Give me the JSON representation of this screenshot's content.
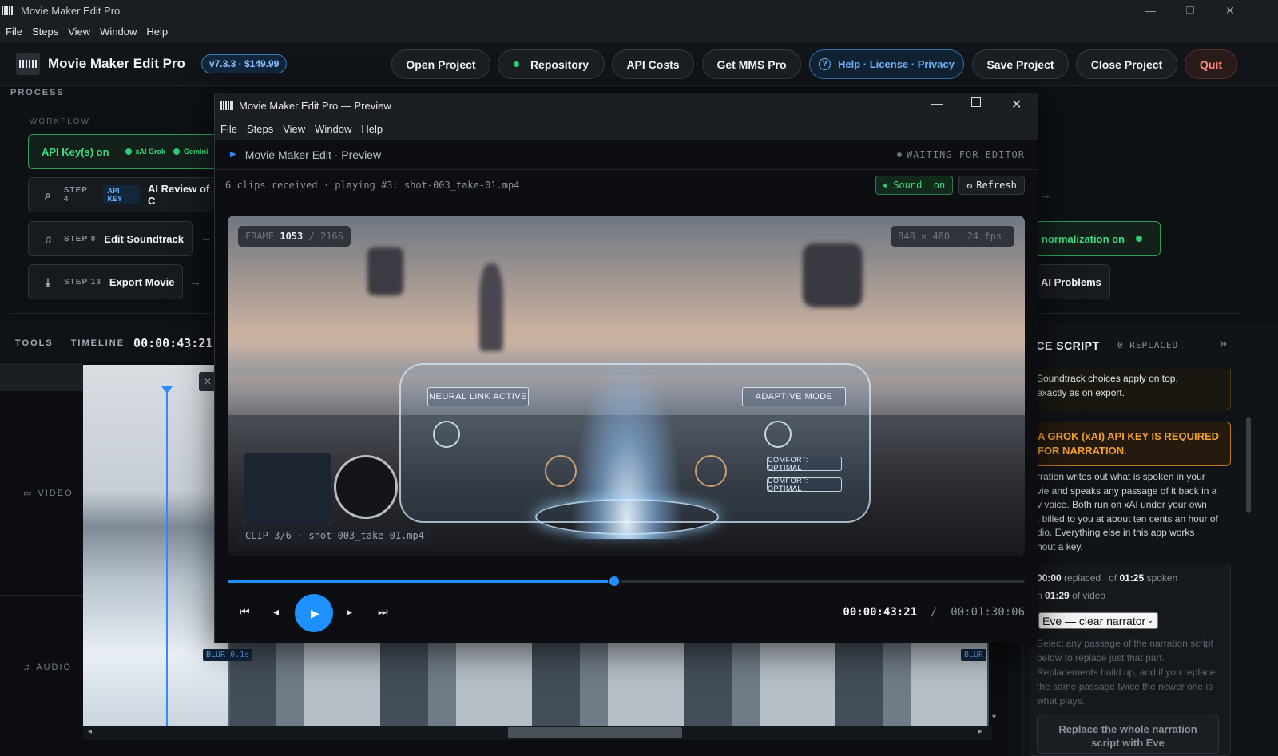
{
  "window": {
    "title": "Movie Maker Edit Pro"
  },
  "menu": [
    "File",
    "Steps",
    "View",
    "Window",
    "Help"
  ],
  "header": {
    "app_name": "Movie Maker Edit Pro",
    "version": "v7.3.3 · $149.99",
    "buttons": {
      "open": "Open Project",
      "repository": "Repository",
      "api_costs": "API Costs",
      "get_pro": "Get MMS Pro",
      "help": "Help · License · Privacy",
      "save": "Save Project",
      "close": "Close Project",
      "quit": "Quit"
    }
  },
  "process": {
    "label": "PROCESS",
    "workflow_label": "WORKFLOW",
    "api_keys": {
      "label": "API Key(s) on",
      "providers": [
        "xAI Grok",
        "Gemini"
      ]
    },
    "steps": [
      {
        "tag": "STEP 4",
        "badge": "API KEY",
        "label": "AI Review of C"
      },
      {
        "tag": "STEP 8",
        "label": "Edit Soundtrack"
      },
      {
        "tag": "STEP 13",
        "label": "Export Movie"
      }
    ],
    "right_steps": {
      "normalization": "normalization on",
      "ai_problems": "AI Problems"
    }
  },
  "tools": {
    "label": "TOOLS",
    "timeline_label": "TIMELINE",
    "timecode": "00:00:43:21",
    "sep": "/"
  },
  "tracks": {
    "video": "VIDEO",
    "audio": "AUDIO",
    "blur_left": "BLUR 0.1s",
    "blur_right": "BLUR",
    "close_glyph": "✕"
  },
  "preview": {
    "title": "Movie Maker Edit Pro — Preview",
    "header": "Movie Maker Edit · Preview",
    "waiting": "WAITING FOR EDITOR",
    "status": "6 clips received · playing #3: shot-003_take-01.mp4",
    "sound_btn": {
      "label": "Sound",
      "state": "on"
    },
    "refresh_btn": "Refresh",
    "frame": {
      "label": "FRAME",
      "current": "1053",
      "sep": "/",
      "total": "2166"
    },
    "resolution": "848 × 480 · 24 fps",
    "clip": "CLIP 3/6 · shot-003_take-01.mp4",
    "hud": {
      "left": "NEURAL LINK ACTIVE",
      "right": "ADAPTIVE MODE",
      "comfort1": "COMFORT: OPTIMAL",
      "comfort2": "COMFORT: OPTIMAL"
    },
    "progress": 0.485,
    "time_current": "00:00:43:21",
    "time_sep": "/",
    "time_total": "00:01:30:06"
  },
  "voice_panel": {
    "title": "ICE SCRIPT",
    "replaced": "0 REPLACED",
    "note": [
      "Soundtrack choices apply on top,",
      "exactly as on export."
    ],
    "warning": [
      "A GROK (xAI) API KEY IS REQUIRED",
      "FOR NARRATION."
    ],
    "description": [
      "rration writes out what is spoken in your",
      "vie and speaks any passage of it back in a",
      "v voice. Both run on xAI under your own",
      ", billed to you at about ten cents an hour of",
      "dio. Everything else in this app works",
      "hout a key."
    ],
    "stats": {
      "replaced_val": "00:00",
      "replaced_lbl": "replaced",
      "of1": "of",
      "spoken_val": "01:25",
      "spoken_lbl": "spoken",
      "of_prefix": "n",
      "video_val": "01:29",
      "video_lbl": "of video"
    },
    "voice_select": "Eve — clear narrator",
    "hint": [
      "Select any passage of the narration script",
      "below to replace just that part.",
      "Replacements build up, and if you replace",
      "the same passage twice the newer one is",
      "what plays."
    ],
    "replace_btn": [
      "Replace the whole narration",
      "script with Eve"
    ]
  },
  "colors": {
    "accent": "#1e90ff",
    "green": "#2ecc71",
    "quit": "#ff8a7a",
    "warning": "#f0a030"
  }
}
